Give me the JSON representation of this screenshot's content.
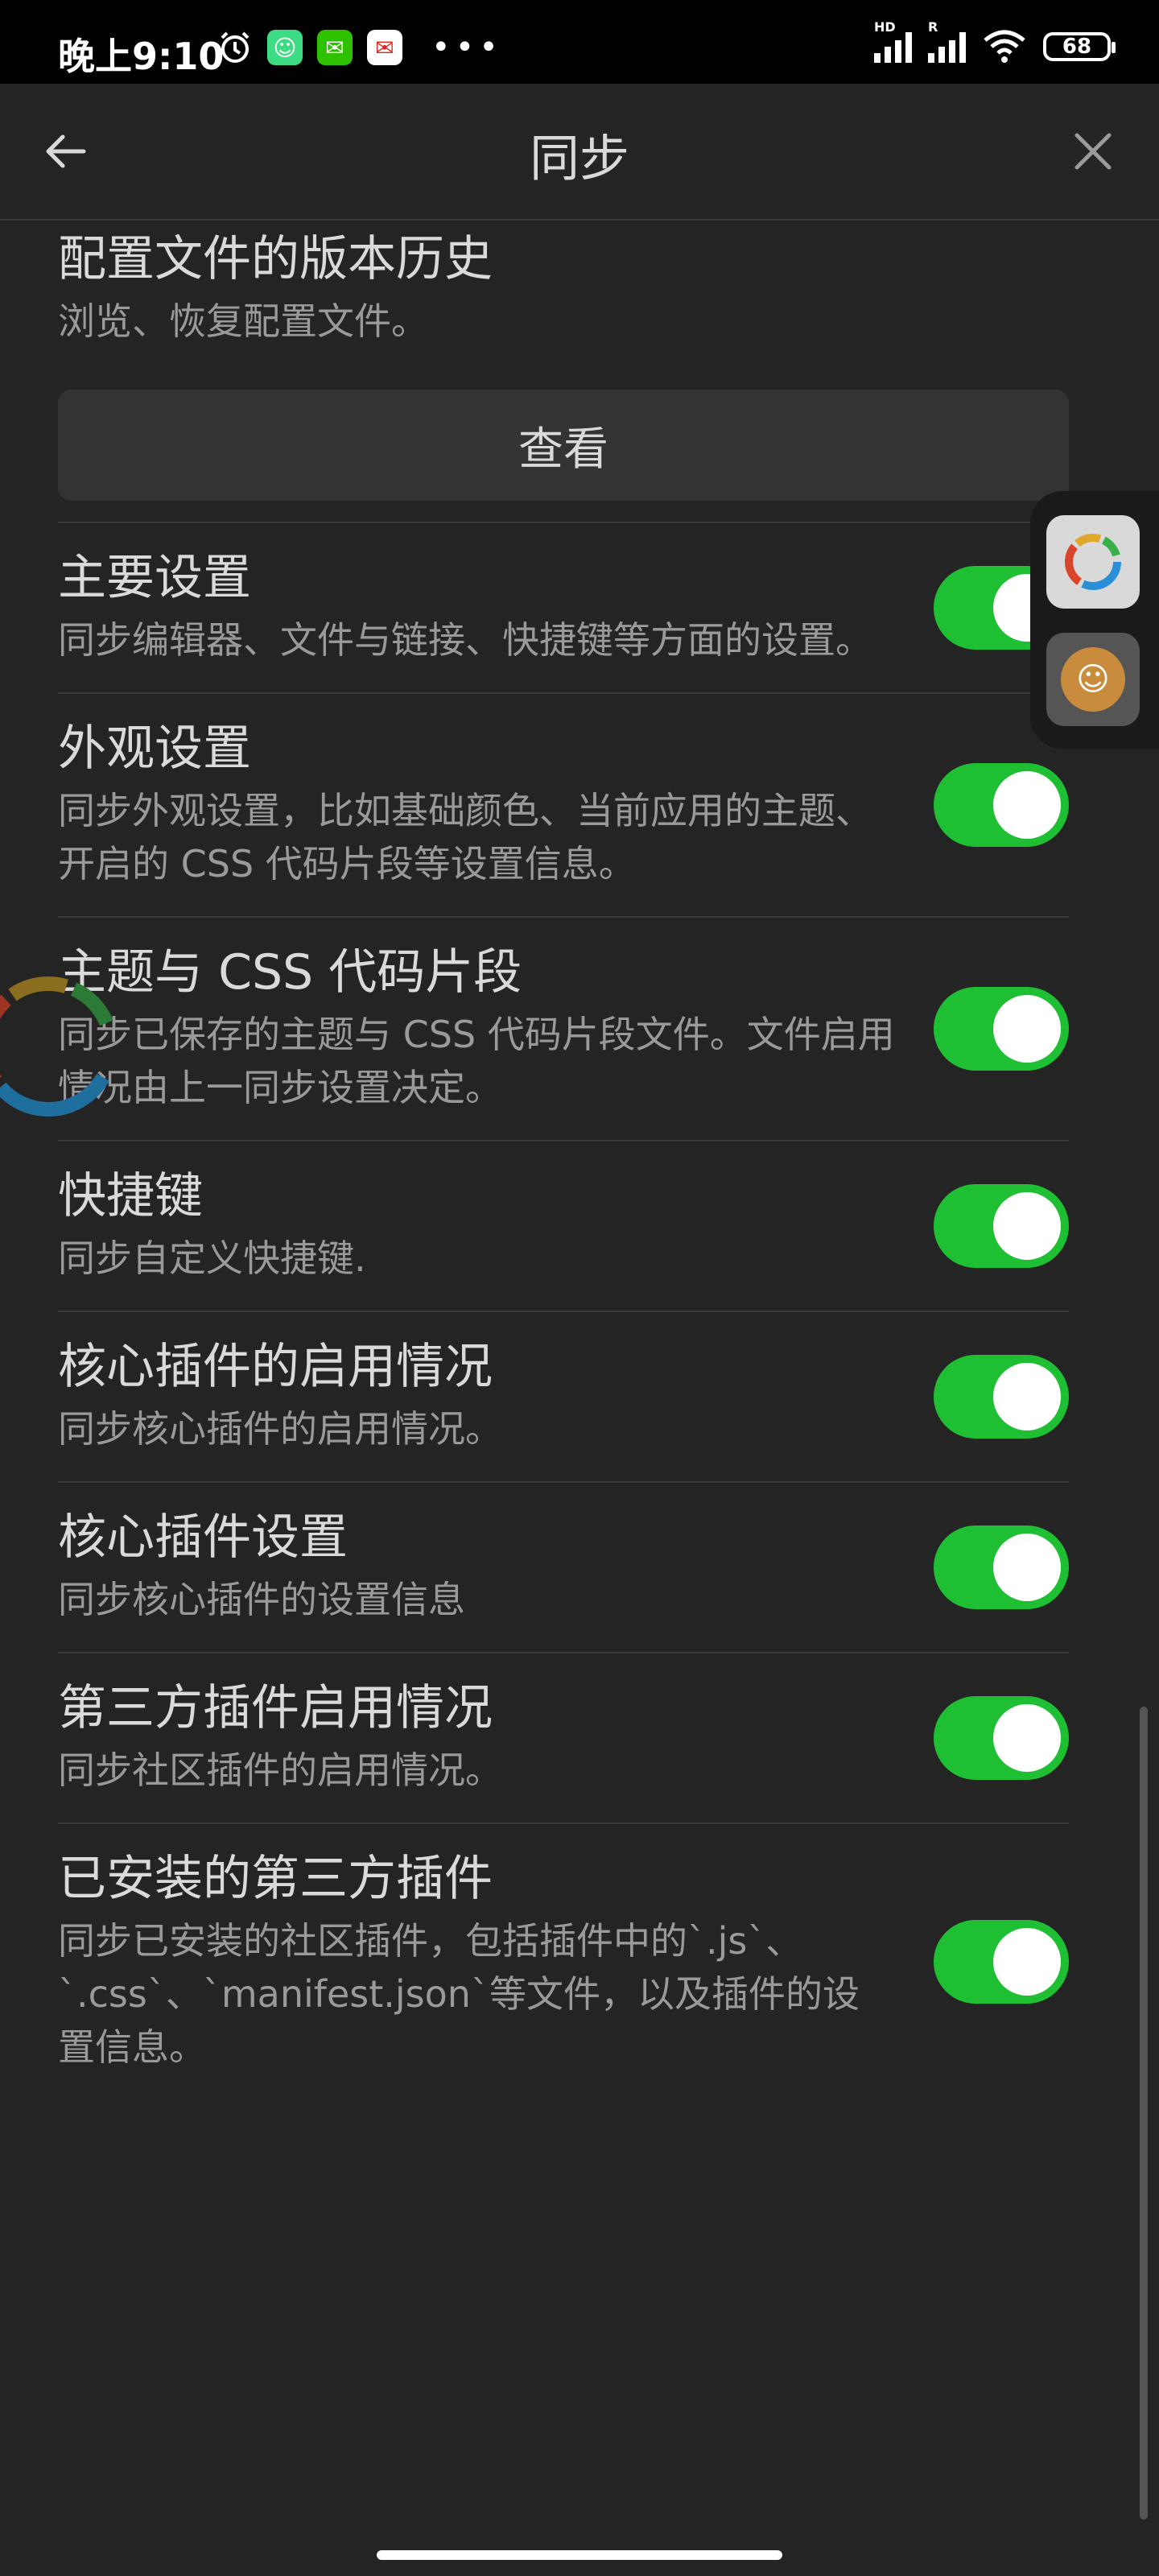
{
  "status_bar": {
    "time": "晚上9:10",
    "battery": "68",
    "signal1_label": "HD",
    "signal2_label": "R"
  },
  "header": {
    "title": "同步"
  },
  "profile_history": {
    "name": "配置文件的版本历史",
    "desc": "浏览、恢复配置文件。",
    "button": "查看"
  },
  "settings": [
    {
      "name": "主要设置",
      "desc": "同步编辑器、文件与链接、快捷键等方面的设置。",
      "enabled": true
    },
    {
      "name": "外观设置",
      "desc": "同步外观设置，比如基础颜色、当前应用的主题、开启的 CSS 代码片段等设置信息。",
      "enabled": true
    },
    {
      "name": "主题与 CSS 代码片段",
      "desc": "同步已保存的主题与 CSS 代码片段文件。文件启用情况由上一同步设置决定。",
      "enabled": true
    },
    {
      "name": "快捷键",
      "desc": "同步自定义快捷键.",
      "enabled": true
    },
    {
      "name": "核心插件的启用情况",
      "desc": "同步核心插件的启用情况。",
      "enabled": true
    },
    {
      "name": "核心插件设置",
      "desc": "同步核心插件的设置信息",
      "enabled": true
    },
    {
      "name": "第三方插件启用情况",
      "desc": "同步社区插件的启用情况。",
      "enabled": true
    },
    {
      "name": "已安装的第三方插件",
      "desc": "同步已安装的社区插件，包括插件中的`.js`、`.css`、`manifest.json`等文件，以及插件的设置信息。",
      "enabled": true
    }
  ],
  "colors": {
    "background": "#242424",
    "toggle_on": "#1fbf34",
    "text_primary": "#dadada",
    "text_secondary": "#9a9a9a"
  },
  "icons": {
    "back": "arrow-left-icon",
    "close": "close-icon",
    "alarm": "alarm-icon",
    "wifi": "wifi-icon"
  }
}
